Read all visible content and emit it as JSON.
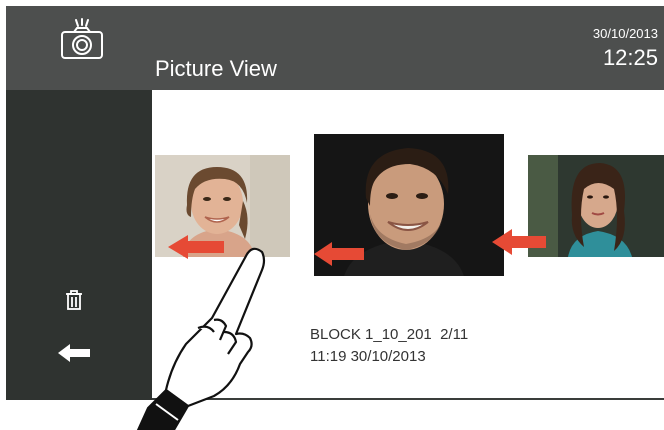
{
  "header": {
    "title": "Picture View",
    "date": "30/10/2013",
    "time": "12:25",
    "icon": "camera-flash-icon"
  },
  "sidebar": {
    "items": [
      {
        "icon": "trash-icon"
      },
      {
        "icon": "back-arrow-icon"
      }
    ]
  },
  "gallery": {
    "photos": [
      {
        "position": "previous"
      },
      {
        "position": "current"
      },
      {
        "position": "next"
      }
    ],
    "swipe_direction": "left"
  },
  "caption": {
    "line1": "BLOCK 1_10_201  2/11",
    "line2": "11:19 30/10/2013"
  },
  "colors": {
    "header_bg": "#4d4f4e",
    "sidebar_bg": "#2f3330",
    "arrow": "#e64a35",
    "text_light": "#ffffff"
  }
}
